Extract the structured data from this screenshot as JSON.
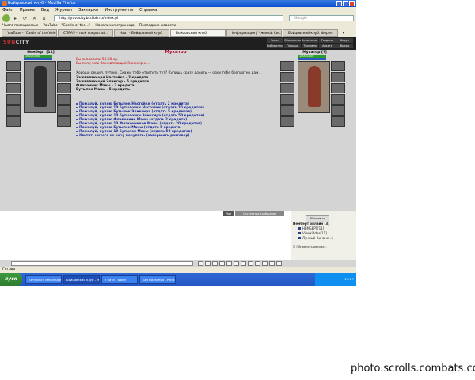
{
  "browser": {
    "title": "Бойцовский клуб - Mozilla Firefox",
    "menu": [
      "Файл",
      "Правка",
      "Вид",
      "Журнал",
      "Закладки",
      "Инструменты",
      "Справка"
    ],
    "url": "http://yuvacity.bcdlbb.ru/index.pl",
    "search_placeholder": "Google",
    "bookmarks": [
      "Часто посещаемые",
      "YouTube - \"Castle of the...\"",
      "Начальная страница",
      "Последние новости"
    ],
    "tabs": [
      {
        "label": "YouTube - \"Castle of the Vale\"",
        "active": false
      },
      {
        "label": "СПРАЧ - твой сокрытый...",
        "active": false
      },
      {
        "label": "Чаат - Бойцовский клуб",
        "active": false
      },
      {
        "label": "Бойцовский клуб",
        "active": true
      },
      {
        "label": "Информация | Чжамой Сис...",
        "active": false
      },
      {
        "label": "Бойцовский клуб. Форум",
        "active": false
      }
    ],
    "status": "Готово"
  },
  "game": {
    "logo_prefix": "SUN",
    "logo_suffix": "CITY",
    "nav": [
      "Закон",
      "Объявления",
      "Безопасность",
      "Разделы",
      "Форум",
      "Библиотека",
      "Помощь",
      "Торговля",
      "Анкета",
      "Выход"
    ],
    "left_char": {
      "name": "Немберт [11]",
      "hp": "1000/1000"
    },
    "right_char": {
      "name": "Мухатор [?]",
      "hp": "1000/1000"
    },
    "npc": {
      "name": "Мухатор",
      "lines": [
        {
          "text": "Вы заплатили 50.00 кр.",
          "style": "red"
        },
        {
          "text": "Вы получили Заживляющий Эликсир x ...",
          "style": "red"
        },
        {
          "text": "Хорошо решил, путник. Скажи тебе ответить тут? Купишь сразу досить — одну тебе бесплатно дам.",
          "style": "normal"
        },
        {
          "text": "Заживляющая Настойка - 2 кредита.",
          "style": "bold"
        },
        {
          "text": "Заживляющий Эликсир - 5 кредитов.",
          "style": "bold"
        },
        {
          "text": "Флакончик Маны - 2 кредита.",
          "style": "bold"
        },
        {
          "text": "Бутылек Маны - 5 кредита.",
          "style": "bold"
        }
      ],
      "options": [
        "Пожалуй, куплю Бутылок Настойки (отдать 2 кредита)",
        "Пожалуй, куплю 10 бутылочки Настойки (отдать 20 кредитов)",
        "Пожалуй, куплю Бутылок Эликсира (отдать 5 кредитов)",
        "Пожалуй, куплю 10 бутылочки Эликсира (отдать 50 кредитов)",
        "Пожалуй, куплю Флакончик Маны (отдать 2 кредита)",
        "Пожалуй, куплю 10 Флакончиков Маны (отдать 20 кредитов)",
        "Пожалуй, куплю Бутылек Маны (отдать 5 кредита)",
        "Пожалуй, куплю 10 бутылок Маны (отдать 50 кредитов)",
        "Хватит, ничего не хочу покупать. (завершить разговор)"
      ]
    },
    "chat": {
      "tab_chat": "Чат",
      "tab_system": "Системные сообщения",
      "refresh": "Обновить",
      "online_header": "Немберт онлайн (3)",
      "online": [
        "НЕМБЕРТ[11]",
        "Viewkiddes[11]",
        "Лунный Кинанс[..]"
      ],
      "auto_update": "Обновлять автомат."
    }
  },
  "taskbar": {
    "start": "пуск",
    "items": [
      {
        "label": "Актуальн. месседжи...",
        "active": false
      },
      {
        "label": "Бойцовский клуб - M",
        "active": true
      },
      {
        "label": "3 чата - Фаен",
        "active": false
      },
      {
        "label": "Без Названия - Paint",
        "active": false
      }
    ],
    "clock": "19:1 ?"
  },
  "watermark": "photo.scrolls.combats.com"
}
